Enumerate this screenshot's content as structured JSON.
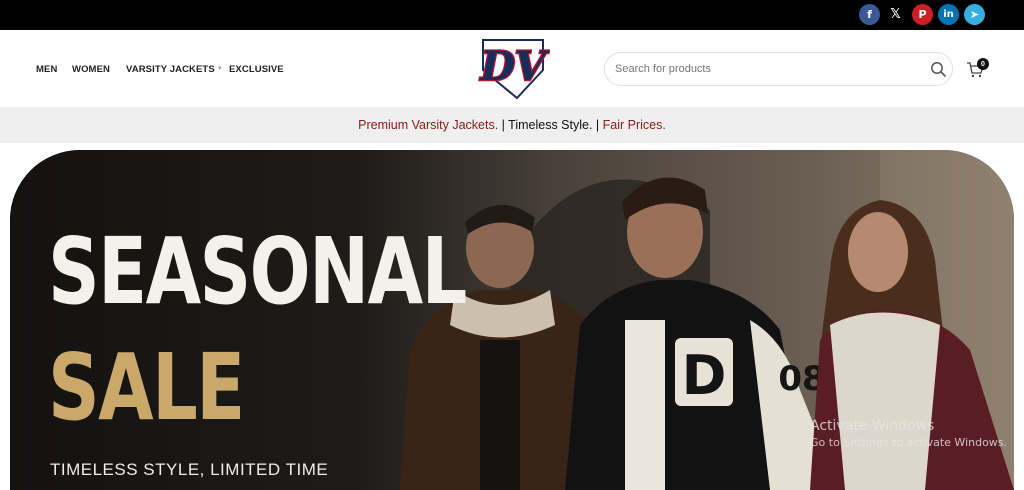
{
  "social": [
    {
      "name": "facebook",
      "glyph": "f"
    },
    {
      "name": "x",
      "glyph": "𝕏"
    },
    {
      "name": "pinterest",
      "glyph": "P"
    },
    {
      "name": "linkedin",
      "glyph": "in"
    },
    {
      "name": "telegram",
      "glyph": "➤"
    }
  ],
  "nav": {
    "men": "MEN",
    "women": "WOMEN",
    "varsity": "VARSITY JACKETS",
    "exclusive": "EXCLUSIVE"
  },
  "logo": {
    "text": "DV",
    "colors": {
      "navy": "#1b2a5c",
      "red": "#b3172d"
    }
  },
  "search": {
    "placeholder": "Search for products"
  },
  "cart": {
    "count": "0"
  },
  "promo": {
    "part1": "Premium Varsity Jackets.",
    "sep1": " | ",
    "part2": "Timeless Style.",
    "sep2": " | ",
    "part3": "Fair Prices."
  },
  "hero": {
    "title_line1": "SEASONAL",
    "title_line2": "SALE",
    "tagline": "TIMELESS STYLE, LIMITED TIME",
    "jacket_letter": "D",
    "jacket_number": "08"
  },
  "watermark": {
    "line1": "Activate Windows",
    "line2": "Go to Settings to activate Windows."
  },
  "colors": {
    "accent_red": "#8b1a1a",
    "gold": "#c9a86a"
  }
}
